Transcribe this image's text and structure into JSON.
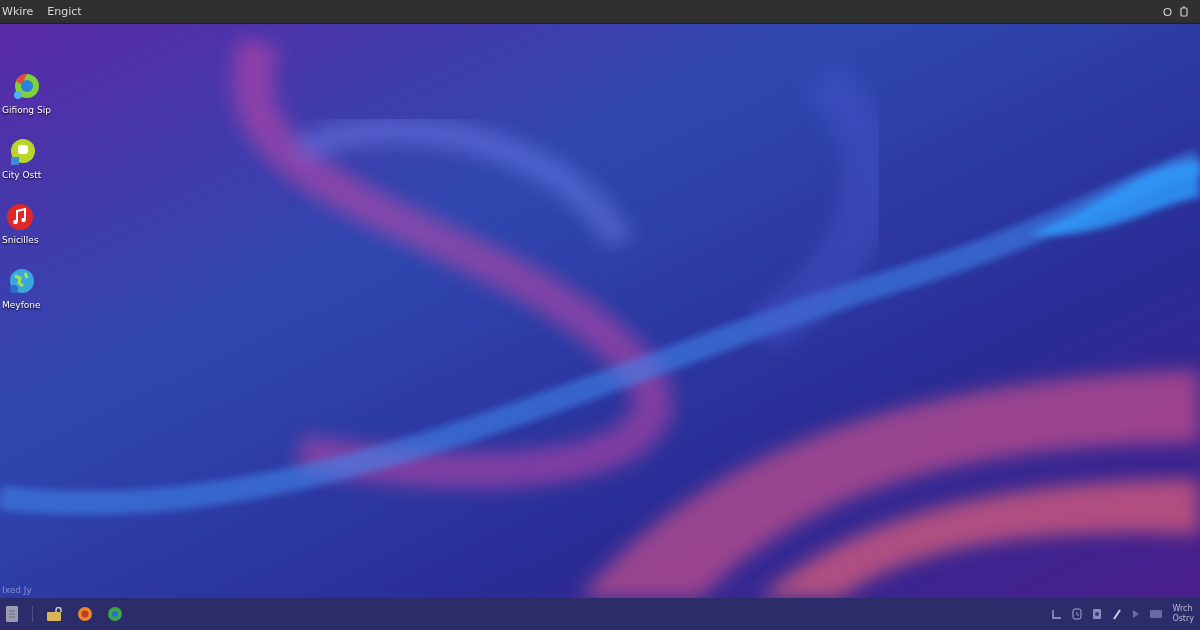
{
  "top_bar": {
    "menus": [
      "Wkire",
      "Engict"
    ]
  },
  "desktop_icons": [
    {
      "label": "Gifiong Sip",
      "kind": "browser"
    },
    {
      "label": "City Ostt",
      "kind": "chat"
    },
    {
      "label": "Snicilles",
      "kind": "music"
    },
    {
      "label": "Meyfone",
      "kind": "globe"
    }
  ],
  "desktop_caption": "Ixed Jy",
  "clock": {
    "line_1": "Wrch",
    "line_2": "Ostry"
  }
}
